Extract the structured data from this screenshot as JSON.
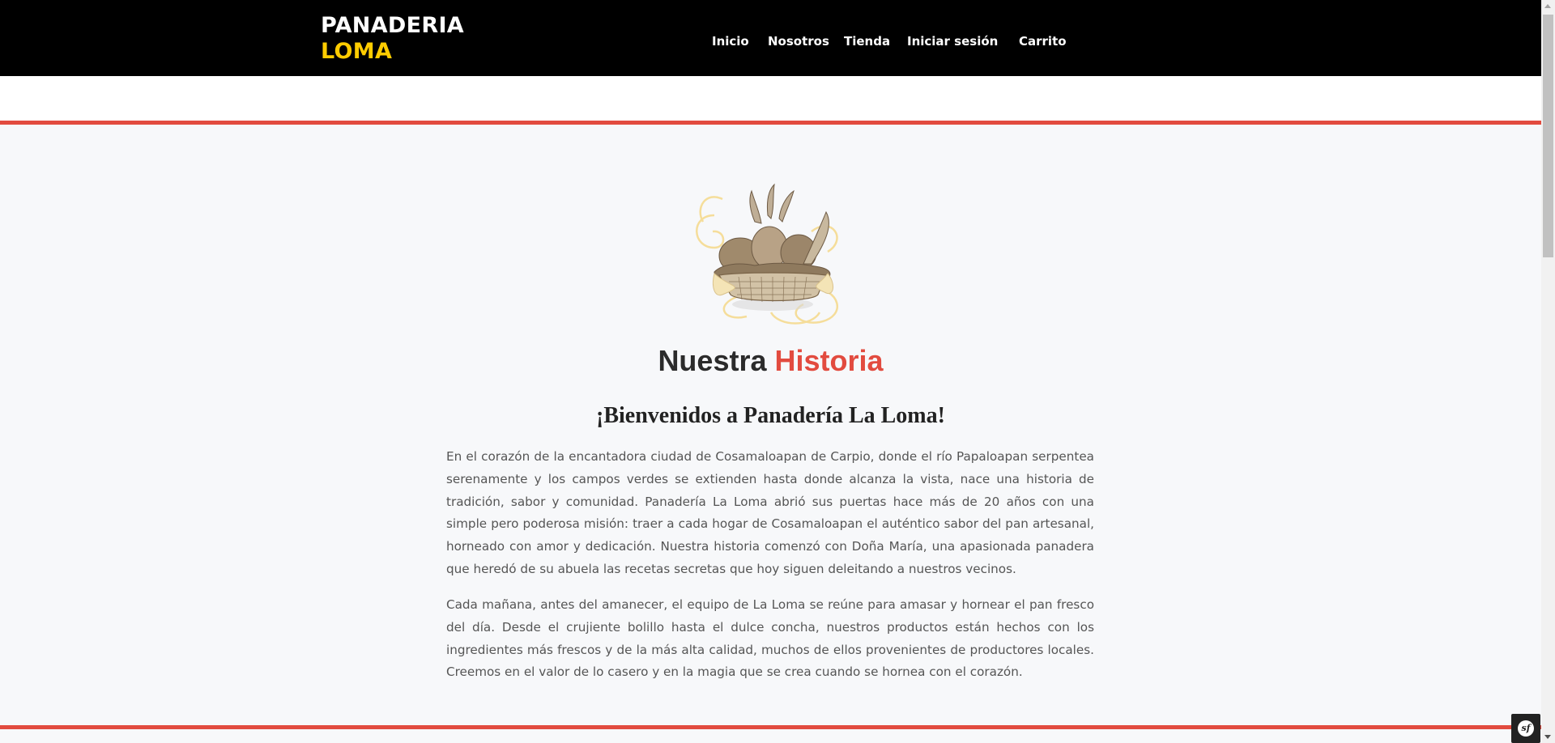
{
  "brand": {
    "line1": "PANADERIA",
    "line2": "LOMA"
  },
  "nav": {
    "items": [
      "Inicio",
      "Nosotros",
      "Tienda",
      "Iniciar sesión",
      "Carrito"
    ]
  },
  "heading": {
    "part1": "Nuestra",
    "part2": "Historia"
  },
  "subtitle": "¡Bienvenidos a Panadería La Loma!",
  "paragraphs": [
    "En el corazón de la encantadora ciudad de Cosamaloapan de Carpio, donde el río Papaloapan serpentea serenamente y los campos verdes se extienden hasta donde alcanza la vista, nace una historia de tradición, sabor y comunidad. Panadería La Loma abrió sus puertas hace más de 20 años con una simple pero poderosa misión: traer a cada hogar de Cosamaloapan el auténtico sabor del pan artesanal, horneado con amor y dedicación. Nuestra historia comenzó con Doña María, una apasionada panadera que heredó de su abuela las recetas secretas que hoy siguen deleitando a nuestros vecinos.",
    "Cada mañana, antes del amanecer, el equipo de La Loma se reúne para amasar y hornear el pan fresco del día. Desde el crujiente bolillo hasta el dulce concha, nuestros productos están hechos con los ingredientes más frescos y de la más alta calidad, muchos de ellos provenientes de productores locales. Creemos en el valor de lo casero y en la magia que se crea cuando se hornea con el corazón."
  ],
  "colors": {
    "accent": "#e24b3f",
    "brand_yellow": "#ffcc00",
    "navbar": "#000000"
  },
  "icons": {
    "hero": "bread-basket-illustration",
    "debug": "symfony-icon"
  },
  "debug_badge": "sf"
}
